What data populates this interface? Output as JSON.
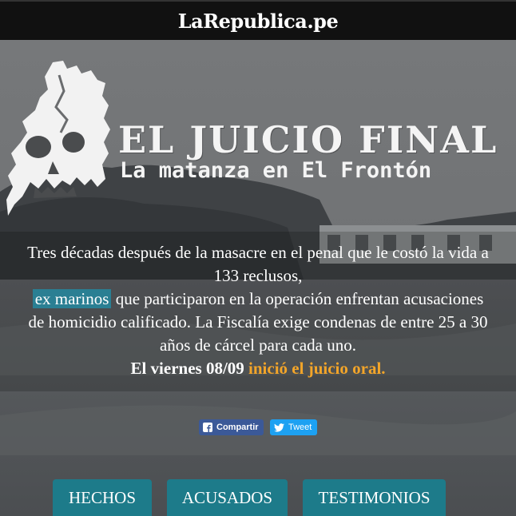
{
  "header": {
    "logo": "LaRepublica.pe"
  },
  "hero": {
    "title": "EL JUICIO FINAL",
    "subtitle": "La matanza en El Frontón",
    "intro_line1": "Tres décadas después de la masacre en el penal que le costó la vida a",
    "intro_line2": "133 reclusos,",
    "intro_highlight": "ex marinos",
    "intro_line3_rest": " que participaron en la operación enfrentan acusaciones",
    "intro_line4": "de homicidio calificado. La Fiscalía exige condenas de entre 25 a 30",
    "intro_line5": "años de cárcel para cada uno.",
    "final_prefix": "El viernes 08/09 ",
    "final_highlight": "inició el juicio oral."
  },
  "share": {
    "facebook_label": "Compartir",
    "twitter_label": "Tweet"
  },
  "nav": {
    "items": [
      {
        "label": "HECHOS"
      },
      {
        "label": "ACUSADOS"
      },
      {
        "label": "TESTIMONIOS"
      }
    ]
  },
  "colors": {
    "topbar": "#111111",
    "highlight": "#2a7f93",
    "accent_orange": "#f3a529",
    "nav_button": "#1d7b8a",
    "facebook": "#3b5998",
    "twitter": "#1da1f2"
  },
  "icons": [
    "skull-logo-icon",
    "facebook-icon",
    "twitter-icon"
  ]
}
